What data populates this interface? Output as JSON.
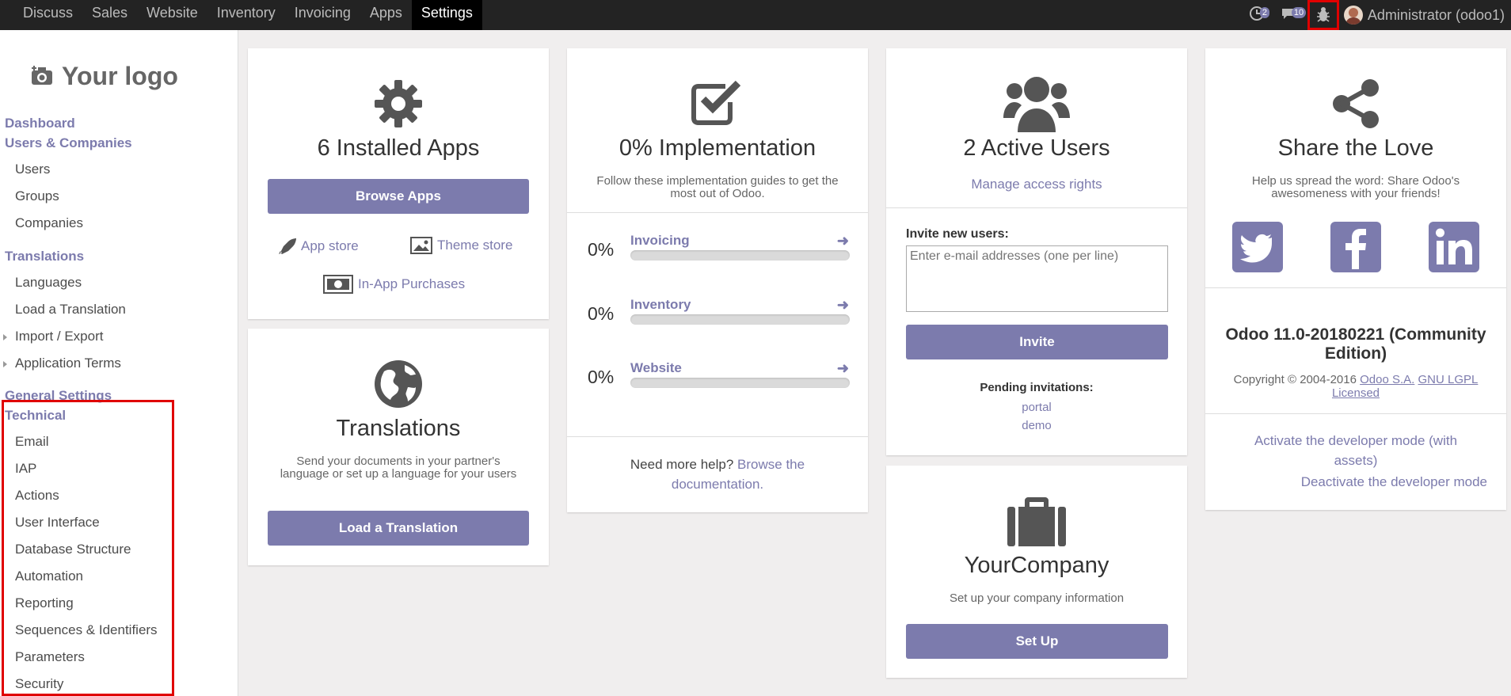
{
  "topbar": {
    "menu": [
      "Discuss",
      "Sales",
      "Website",
      "Inventory",
      "Invoicing",
      "Apps",
      "Settings"
    ],
    "active": "Settings",
    "activity_count": "2",
    "messages_count": "10",
    "user": "Administrator (odoo1)"
  },
  "sidebar": {
    "logo_text": "Your logo",
    "dashboard": "Dashboard",
    "users_companies": "Users & Companies",
    "users": "Users",
    "groups": "Groups",
    "companies": "Companies",
    "translations": "Translations",
    "languages": "Languages",
    "load_translation": "Load a Translation",
    "import_export": "Import / Export",
    "application_terms": "Application Terms",
    "general_settings": "General Settings",
    "technical": "Technical",
    "technical_items": [
      "Email",
      "IAP",
      "Actions",
      "User Interface",
      "Database Structure",
      "Automation",
      "Reporting",
      "Sequences & Identifiers",
      "Parameters",
      "Security"
    ]
  },
  "apps_card": {
    "title": "6 Installed Apps",
    "button": "Browse Apps",
    "app_store": "App store",
    "theme_store": "Theme store",
    "in_app": "In-App Purchases"
  },
  "translations_card": {
    "title": "Translations",
    "description": "Send your documents in your partner's language or set up a language for your users",
    "button": "Load a Translation"
  },
  "implementation_card": {
    "title": "0% Implementation",
    "subtitle": "Follow these implementation guides to get the most out of Odoo.",
    "rows": [
      {
        "pct": "0%",
        "name": "Invoicing"
      },
      {
        "pct": "0%",
        "name": "Inventory"
      },
      {
        "pct": "0%",
        "name": "Website"
      }
    ],
    "help_text": "Need more help?",
    "help_link_1": "Browse the",
    "help_link_2": "documentation."
  },
  "users_card": {
    "title": "2 Active Users",
    "manage_link": "Manage access rights",
    "invite_label": "Invite new users:",
    "invite_placeholder": "Enter e-mail addresses (one per line)",
    "invite_button": "Invite",
    "pending_label": "Pending invitations:",
    "pending": [
      "portal",
      "demo"
    ]
  },
  "company_card": {
    "title": "YourCompany",
    "subtitle": "Set up your company information",
    "button": "Set Up"
  },
  "share_card": {
    "title": "Share the Love",
    "subtitle": "Help us spread the word: Share Odoo's awesomeness with your friends!",
    "version_1": "Odoo 11.0-20180221 (Community",
    "version_2": "Edition)",
    "copyright_prefix": "Copyright © 2004-2016",
    "odoo_sa": "Odoo S.A.",
    "gnu_1": "GNU LGPL",
    "gnu_2": "Licensed",
    "dev_assets_1": "Activate the developer mode (with",
    "dev_assets_2": "assets)",
    "deactivate": "Deactivate the developer mode"
  }
}
